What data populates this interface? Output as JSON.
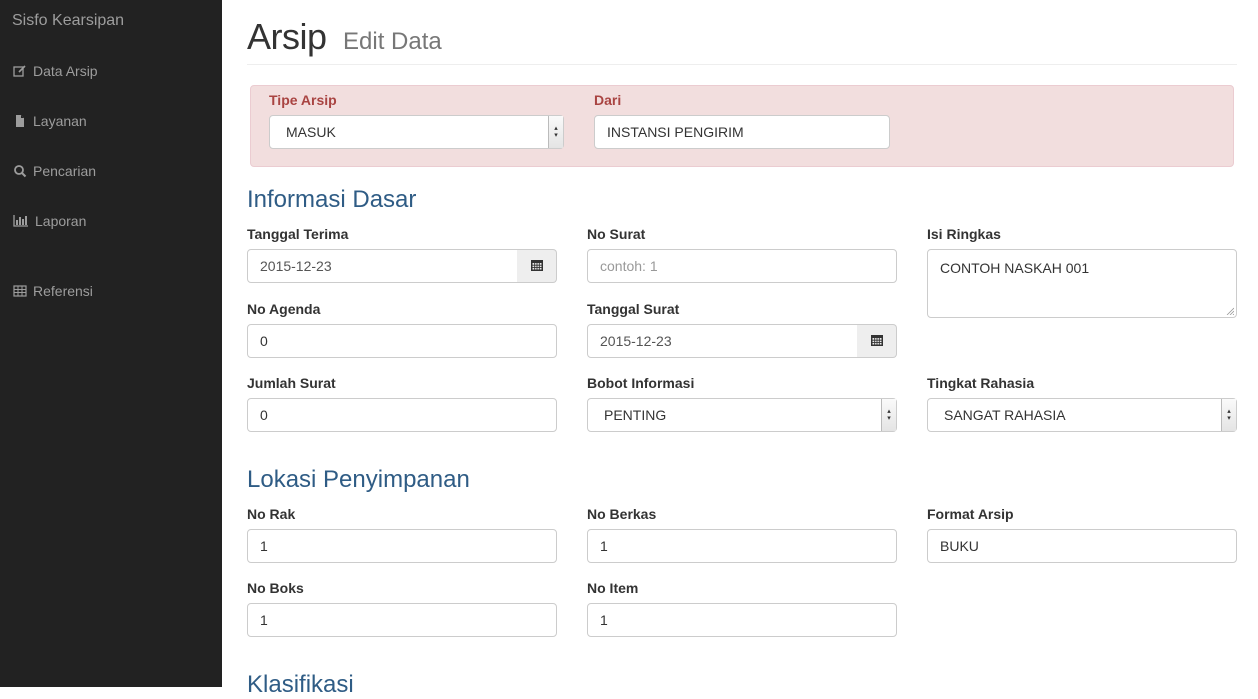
{
  "sidebar": {
    "brand": "Sisfo Kearsipan",
    "items": [
      {
        "label": "Data Arsip",
        "icon": "edit-icon"
      },
      {
        "label": "Layanan",
        "icon": "file-icon"
      },
      {
        "label": "Pencarian",
        "icon": "search-icon"
      },
      {
        "label": "Laporan",
        "icon": "chart-icon"
      },
      {
        "label": "Referensi",
        "icon": "table-icon"
      }
    ]
  },
  "header": {
    "title": "Arsip",
    "subtitle": "Edit Data"
  },
  "alert": {
    "tipe_label": "Tipe Arsip",
    "tipe_value": "MASUK",
    "dari_label": "Dari",
    "dari_value": "INSTANSI PENGIRIM"
  },
  "informasi": {
    "title": "Informasi Dasar",
    "tanggal_terima_label": "Tanggal Terima",
    "tanggal_terima_value": "2015-12-23",
    "no_surat_label": "No Surat",
    "no_surat_placeholder": "contoh: 1",
    "isi_ringkas_label": "Isi Ringkas",
    "isi_ringkas_value": "CONTOH NASKAH 001",
    "no_agenda_label": "No Agenda",
    "no_agenda_value": "0",
    "tanggal_surat_label": "Tanggal Surat",
    "tanggal_surat_value": "2015-12-23",
    "jumlah_surat_label": "Jumlah Surat",
    "jumlah_surat_value": "0",
    "bobot_label": "Bobot Informasi",
    "bobot_value": "PENTING",
    "tingkat_label": "Tingkat Rahasia",
    "tingkat_value": "SANGAT RAHASIA"
  },
  "lokasi": {
    "title": "Lokasi Penyimpanan",
    "no_rak_label": "No Rak",
    "no_rak_value": "1",
    "no_berkas_label": "No Berkas",
    "no_berkas_value": "1",
    "format_label": "Format Arsip",
    "format_value": "BUKU",
    "no_boks_label": "No Boks",
    "no_boks_value": "1",
    "no_item_label": "No Item",
    "no_item_value": "1"
  },
  "klasifikasi": {
    "title": "Klasifikasi"
  },
  "colors": {
    "sidebar_bg": "#222222",
    "section": "#2f5c85",
    "alert_bg": "#f2dede",
    "alert_text": "#a94442"
  }
}
